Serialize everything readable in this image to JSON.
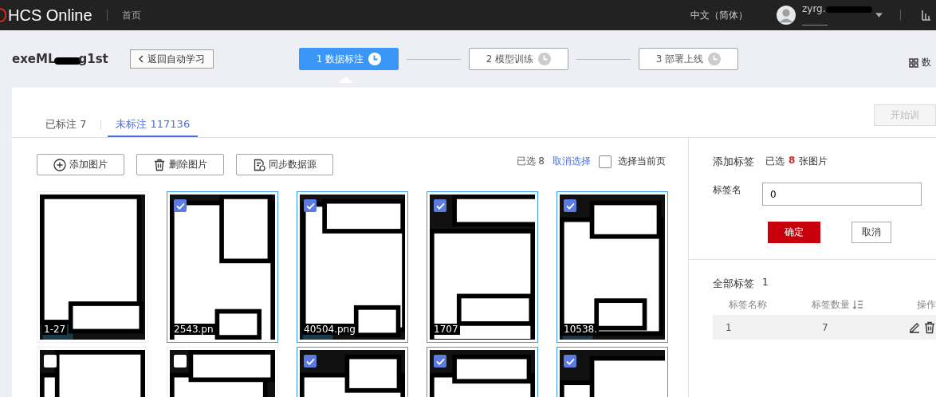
{
  "header": {
    "brand": "HCS Online",
    "nav": "首页",
    "language": "中文（简体）",
    "username": "zyrg."
  },
  "project": {
    "name_start": "exeML",
    "name_end": "g1st",
    "back": "返回自动学习",
    "view_toggle": "数",
    "steps": [
      {
        "label": "1 数据标注",
        "selected": true
      },
      {
        "label": "2 模型训练",
        "selected": false
      },
      {
        "label": "3 部署上线",
        "selected": false
      }
    ]
  },
  "tabs": [
    {
      "label": "已标注 7",
      "selected": false
    },
    {
      "label": "未标注 117136",
      "selected": true
    }
  ],
  "start_button": {
    "label": "开始训",
    "disabled": true
  },
  "toolbar": {
    "buttons": [
      {
        "kind": "add",
        "label": "添加图片"
      },
      {
        "kind": "delete",
        "label": "删除图片"
      },
      {
        "kind": "sync",
        "label": "同步数据源"
      }
    ],
    "selected_count": "已选 8",
    "clear": "取消选择",
    "select_page": {
      "label": "选择当前页",
      "checked": false
    }
  },
  "images": [
    {
      "caption": "1-27"
    },
    {
      "caption": "2543.pn",
      "checked": true
    },
    {
      "caption": "40504.png",
      "checked": true
    },
    {
      "caption": "1707",
      "checked": true
    },
    {
      "caption": "10538.",
      "checked": true
    },
    {
      "checked": false
    },
    {
      "checked": false
    },
    {
      "checked": true
    },
    {
      "checked": true
    },
    {
      "checked": true
    }
  ],
  "label_panel": {
    "title": "添加标签",
    "selected_prefix": "已选",
    "selected_number": "8",
    "selected_suffix": "张图片",
    "field_label": "标签名",
    "field_value": "0",
    "confirm": "确定",
    "cancel": "取消",
    "all_title": "全部标签",
    "all_count": "1",
    "columns": [
      "标签名称",
      "标签数量",
      "操作"
    ],
    "rows": [
      {
        "name": "1",
        "count": "7"
      }
    ]
  }
}
